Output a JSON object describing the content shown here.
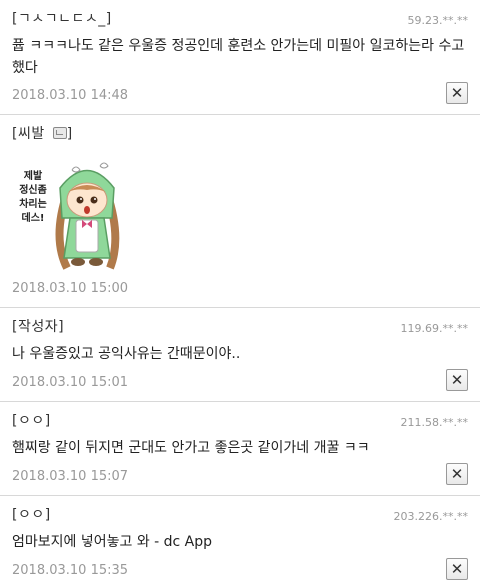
{
  "comments": [
    {
      "author": "[ㄱㅅㄱㄴㄷㅅ_]",
      "ip": "59.23.**.**",
      "body": "퓹 ㅋㅋㅋ나도 같은 우울증 정공인데 훈련소 안가는데 미필아 일코하는라 수고했다",
      "date": "2018.03.10 14:48",
      "delete_label": "✕"
    },
    {
      "author": "[씨발 ",
      "author_suffix": "]",
      "sticker_text": [
        "제발",
        "정신좀",
        "차리는",
        "데스!"
      ],
      "date": "2018.03.10 15:00"
    },
    {
      "author": "[작성자]",
      "ip": "119.69.**.**",
      "body": "나 우울증있고 공익사유는 간때문이야..",
      "date": "2018.03.10 15:01",
      "delete_label": "✕"
    },
    {
      "author": "[ㅇㅇ]",
      "ip": "211.58.**.**",
      "body": "햄찌랑 같이 뒤지면 군대도 안가고 좋은곳 같이가네 개꿀 ㅋㅋ",
      "date": "2018.03.10 15:07",
      "delete_label": "✕"
    },
    {
      "author": "[ㅇㅇ]",
      "ip": "203.226.**.**",
      "body": "엄마보지에 넣어놓고 와 - dc App",
      "date": "2018.03.10 15:35",
      "delete_label": "✕"
    }
  ]
}
